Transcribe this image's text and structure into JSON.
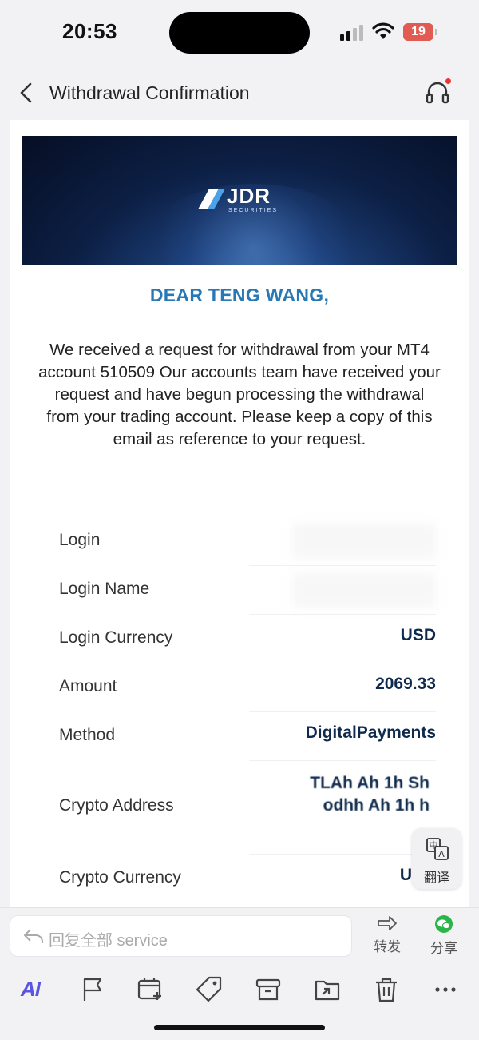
{
  "status_bar": {
    "time": "20:53",
    "battery": "19"
  },
  "nav": {
    "title": "Withdrawal Confirmation",
    "back_icon": "chevron-left-icon",
    "support_icon": "headset-icon"
  },
  "email": {
    "brand": {
      "name": "JDR",
      "sub": "SECURITIES"
    },
    "greeting": "DEAR TENG WANG,",
    "message": "We received a request for withdrawal from your MT4 account 510509 Our accounts team have received your request and have begun processing the withdrawal from your trading account. Please keep a copy of this email as reference to your request.",
    "details": [
      {
        "label": "Login",
        "value": ""
      },
      {
        "label": "Login Name",
        "value": ""
      },
      {
        "label": "Login Currency",
        "value": "USD"
      },
      {
        "label": "Amount",
        "value": "2069.33"
      },
      {
        "label": "Method",
        "value": "DigitalPayments"
      },
      {
        "label": "Crypto Address",
        "value_line1": "TLAh  Ah  1h  Sh",
        "value_line2": "odhh  Ah  1h  h"
      },
      {
        "label": "Crypto Currency",
        "value": "USDT"
      }
    ]
  },
  "translate": {
    "label": "翻译"
  },
  "reply": {
    "placeholder": "回复全部  service"
  },
  "actions": {
    "forward": "转发",
    "share": "分享"
  },
  "toolbar": {
    "ai": "AI"
  },
  "colors": {
    "accent": "#2778b5",
    "value_text": "#0e2a4d",
    "ai": "#5a55e0",
    "wechat_green": "#2ab54a"
  }
}
